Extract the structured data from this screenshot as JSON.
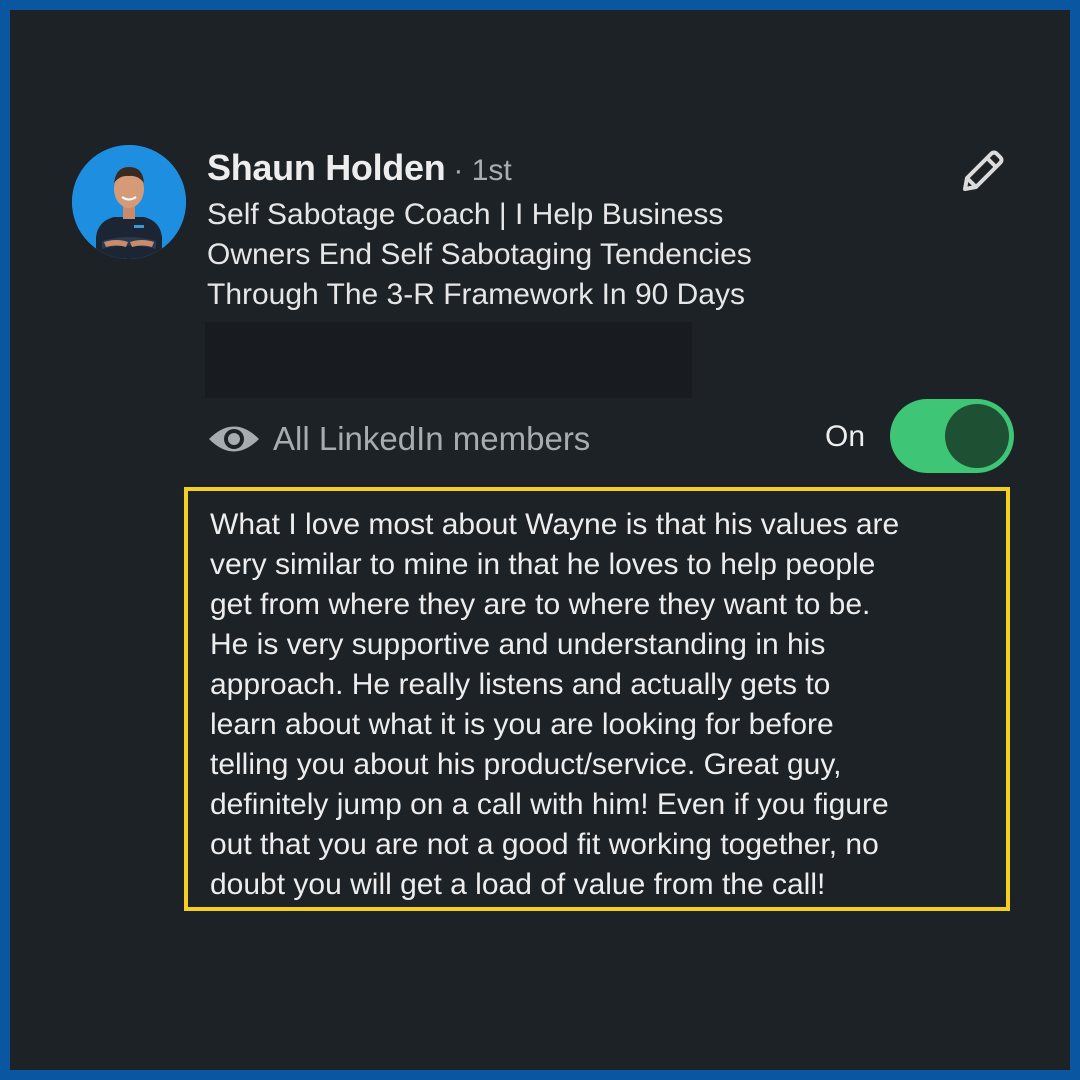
{
  "profile": {
    "name": "Shaun Holden",
    "degree": "· 1st",
    "headline_lines": [
      "Self Sabotage Coach  | I Help Business",
      "Owners End Self Sabotaging Tendencies",
      "Through The 3-R Framework In 90 Days"
    ],
    "avatar_icon": "person-photo-icon"
  },
  "edit": {
    "icon": "pencil-icon"
  },
  "visibility": {
    "icon": "eye-icon",
    "label": "All LinkedIn members",
    "toggle_text": "On",
    "toggle_on": true
  },
  "recommendation": {
    "lines": [
      "What I love most about Wayne is that his values are",
      "very similar to mine in that he loves to help people",
      "get from where they are to where they want to be.",
      "He is very supportive and understanding in his",
      "approach. He really listens and actually gets to",
      "learn about what it is you are looking for before",
      "telling you about his product/service. Great guy,",
      "definitely jump on a call with him! Even if you figure",
      "out that you are not a good fit working together, no",
      "doubt you will get a load of value from the call!"
    ]
  },
  "colors": {
    "outer_border": "#0a56a0",
    "background": "#1d2226",
    "toggle_track": "#3ec676",
    "toggle_knob": "#1e5133",
    "highlight_border": "#f4cf1f"
  }
}
